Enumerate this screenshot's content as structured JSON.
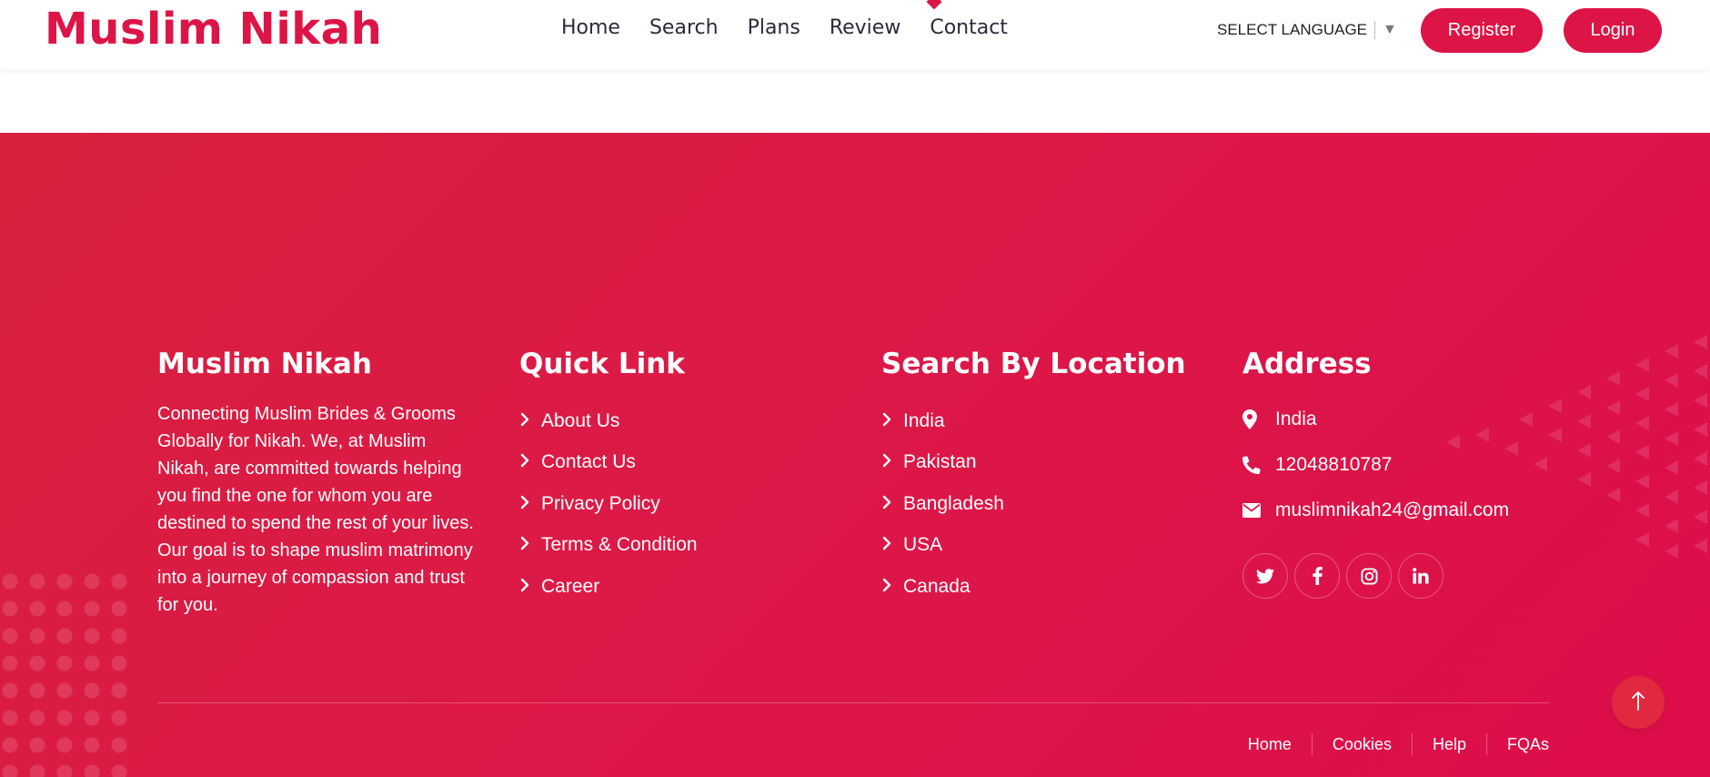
{
  "header": {
    "logo": "Muslim Nikah",
    "nav": [
      "Home",
      "Search",
      "Plans",
      "Review",
      "Contact"
    ],
    "language_label": "SELECT LANGUAGE",
    "register_label": "Register",
    "login_label": "Login"
  },
  "footer": {
    "about": {
      "title": "Muslim Nikah",
      "text": "Connecting Muslim Brides & Grooms Globally for Nikah. We, at Muslim Nikah, are committed towards helping you find the one for whom you are destined to spend the rest of your lives. Our goal is to shape muslim matrimony into a journey of compassion and trust for you."
    },
    "quick_links": {
      "title": "Quick Link",
      "items": [
        "About Us",
        "Contact Us",
        "Privacy Policy",
        "Terms & Condition",
        "Career"
      ]
    },
    "locations": {
      "title": "Search By Location",
      "items": [
        "India",
        "Pakistan",
        "Bangladesh",
        "USA",
        "Canada"
      ]
    },
    "address": {
      "title": "Address",
      "location": "India",
      "phone": "12048810787",
      "email": "muslimnikah24@gmail.com"
    },
    "socials": [
      "twitter-icon",
      "facebook-icon",
      "instagram-icon",
      "linkedin-icon"
    ],
    "bottom_links": [
      "Home",
      "Cookies",
      "Help",
      "FQAs"
    ]
  },
  "colors": {
    "brand": "#dd1446",
    "footer_bg": "#dc1848"
  }
}
